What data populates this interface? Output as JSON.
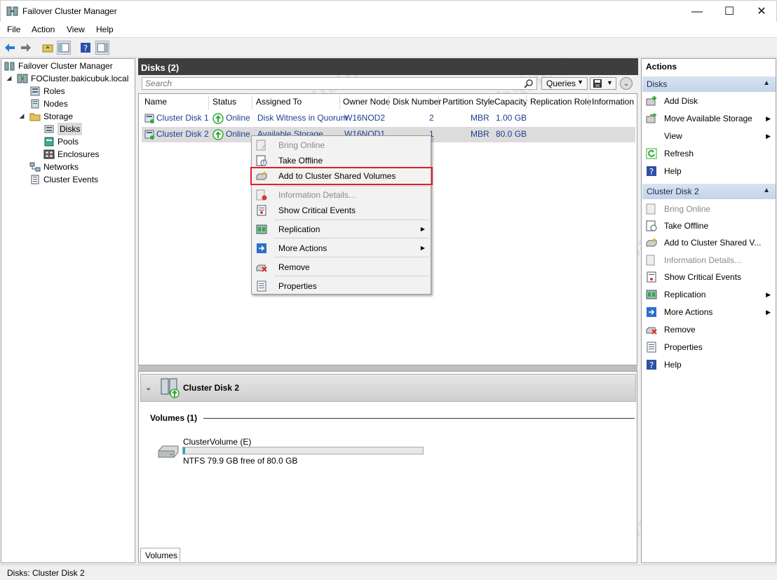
{
  "window": {
    "title": "Failover Cluster Manager",
    "minimize": "—",
    "maximize": "☐",
    "close": "✕"
  },
  "menu": [
    "File",
    "Action",
    "View",
    "Help"
  ],
  "tree": {
    "root": "Failover Cluster Manager",
    "cluster": "FOCluster.bakicubuk.local",
    "roles": "Roles",
    "nodes": "Nodes",
    "storage": "Storage",
    "disks": "Disks",
    "pools": "Pools",
    "enclosures": "Enclosures",
    "networks": "Networks",
    "events": "Cluster Events"
  },
  "center": {
    "header": "Disks (2)",
    "search_placeholder": "Search",
    "queries_label": "Queries",
    "columns": [
      "Name",
      "Status",
      "Assigned To",
      "Owner Node",
      "Disk Number",
      "Partition Style",
      "Capacity",
      "Replication Role",
      "Information"
    ],
    "rows": [
      {
        "name": "Cluster Disk 1",
        "status": "Online",
        "assigned": "Disk Witness in Quorum",
        "owner": "W16NOD2",
        "disknum": "2",
        "style": "MBR",
        "capacity": "1.00 GB"
      },
      {
        "name": "Cluster Disk 2",
        "status": "Online",
        "assigned": "Available Storage",
        "owner": "W16NOD1",
        "disknum": "1",
        "style": "MBR",
        "capacity": "80.0 GB"
      }
    ]
  },
  "context_menu": {
    "bring_online": "Bring Online",
    "take_offline": "Take Offline",
    "add_csv": "Add to Cluster Shared Volumes",
    "info_details": "Information Details...",
    "critical_events": "Show Critical Events",
    "replication": "Replication",
    "more_actions": "More Actions",
    "remove": "Remove",
    "properties": "Properties"
  },
  "detail": {
    "title": "Cluster Disk 2",
    "volumes_heading": "Volumes (1)",
    "volume_name": "ClusterVolume (E)",
    "volume_info": "NTFS 79.9 GB free of 80.0 GB",
    "used_fraction": 0.0013,
    "tab": "Volumes"
  },
  "actions": {
    "title": "Actions",
    "section1": "Disks",
    "add_disk": "Add Disk",
    "move_storage": "Move Available Storage",
    "view": "View",
    "refresh": "Refresh",
    "help": "Help",
    "section2": "Cluster Disk 2",
    "bring_online": "Bring Online",
    "take_offline": "Take Offline",
    "add_csv": "Add to Cluster Shared V...",
    "info_details": "Information Details...",
    "critical_events": "Show Critical Events",
    "replication": "Replication",
    "more_actions": "More Actions",
    "remove": "Remove",
    "properties": "Properties",
    "help2": "Help"
  },
  "status": "Disks:  Cluster Disk 2",
  "watermark": "bakicubuk",
  "colors": {
    "accent": "#3e3e3e",
    "selection": "#dcdcdc",
    "highlight": "#e02020",
    "action_header": "#c3d4ea"
  }
}
